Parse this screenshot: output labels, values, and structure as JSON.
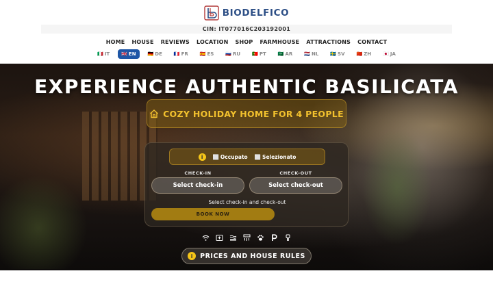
{
  "brand": {
    "name": "BIODELFICO",
    "logo_icon": "b-logo-icon",
    "color": "#2d4f86"
  },
  "cin": "CIN: IT077016C203192001",
  "nav": [
    "HOME",
    "HOUSE",
    "REVIEWS",
    "LOCATION",
    "SHOP",
    "FARMHOUSE",
    "ATTRACTIONS",
    "CONTACT"
  ],
  "languages": [
    {
      "code": "IT",
      "flag": "🇮🇹",
      "active": false
    },
    {
      "code": "EN",
      "flag": "🇬🇧",
      "active": true
    },
    {
      "code": "DE",
      "flag": "🇩🇪",
      "active": false
    },
    {
      "code": "FR",
      "flag": "🇫🇷",
      "active": false
    },
    {
      "code": "ES",
      "flag": "🇪🇸",
      "active": false
    },
    {
      "code": "RU",
      "flag": "🇷🇺",
      "active": false
    },
    {
      "code": "PT",
      "flag": "🇵🇹",
      "active": false
    },
    {
      "code": "AR",
      "flag": "🇸🇦",
      "active": false
    },
    {
      "code": "NL",
      "flag": "🇳🇱",
      "active": false
    },
    {
      "code": "SV",
      "flag": "🇸🇪",
      "active": false
    },
    {
      "code": "ZH",
      "flag": "🇨🇳",
      "active": false
    },
    {
      "code": "JA",
      "flag": "🇯🇵",
      "active": false
    }
  ],
  "hero": {
    "title": "EXPERIENCE AUTHENTIC BASILICATA",
    "subtitle": "COZY HOLIDAY HOME FOR 4 PEOPLE",
    "subtitle_icon": "house-icon"
  },
  "booking": {
    "legend": {
      "info": "i",
      "occupied_marker": "⬜",
      "occupied": "Occupato",
      "selected_marker": "⬜",
      "selected": "Selezionato"
    },
    "checkin_label": "CHECK-IN",
    "checkout_label": "CHECK-OUT",
    "checkin_button": "Select check-in",
    "checkout_button": "Select check-out",
    "hint": "Select check-in and check-out",
    "book_now": "BOOK NOW"
  },
  "amenities": [
    "wifi-icon",
    "first-aid-icon",
    "heating-icon",
    "air-conditioning-icon",
    "pets-icon",
    "parking-icon",
    "hair-dryer-icon"
  ],
  "rules_button": {
    "info": "i",
    "label": "PRICES AND HOUSE RULES"
  },
  "colors": {
    "accent": "#f2c12e",
    "active_lang": "#1e56a6",
    "book_button": "#a27c12"
  }
}
